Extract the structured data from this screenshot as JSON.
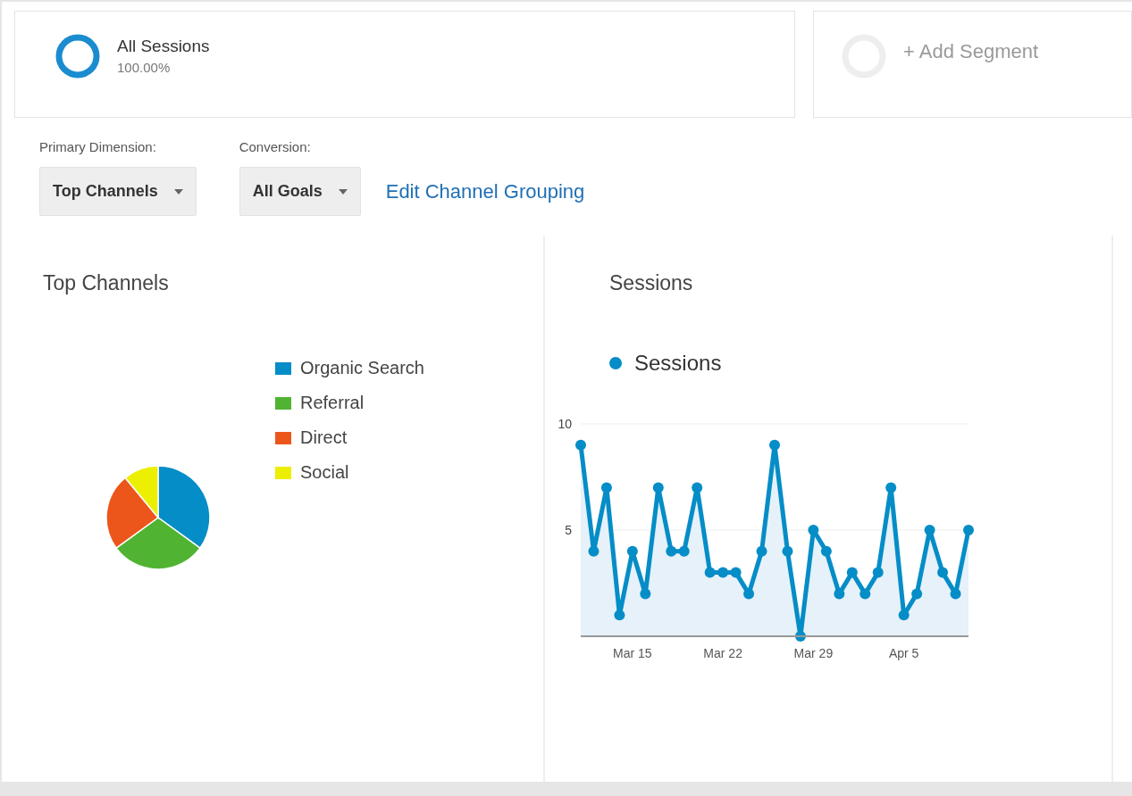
{
  "segments": [
    {
      "name": "All Sessions",
      "percent": "100.00%",
      "kind": "active"
    },
    {
      "name": "+ Add Segment",
      "kind": "add"
    }
  ],
  "controls": {
    "primary_dimension": {
      "label": "Primary Dimension:",
      "value": "Top Channels"
    },
    "conversion": {
      "label": "Conversion:",
      "value": "All Goals"
    },
    "link": "Edit Channel Grouping"
  },
  "top_channels": {
    "title": "Top Channels",
    "legend": [
      {
        "label": "Organic Search",
        "color": "#058dc7"
      },
      {
        "label": "Referral",
        "color": "#50b432"
      },
      {
        "label": "Direct",
        "color": "#ed561b"
      },
      {
        "label": "Social",
        "color": "#edef00"
      }
    ]
  },
  "sessions": {
    "title": "Sessions",
    "chart_data": {
      "type": "line",
      "categories": [
        null,
        null,
        null,
        null,
        "Mar 15",
        null,
        null,
        null,
        null,
        null,
        null,
        "Mar 22",
        null,
        null,
        null,
        null,
        null,
        null,
        "Mar 29",
        null,
        null,
        null,
        null,
        null,
        null,
        "Apr 5",
        null,
        null,
        null,
        null,
        null
      ],
      "series": [
        {
          "name": "Sessions",
          "color": "#058dc7",
          "marker": "circle",
          "values": [
            9,
            4,
            7,
            1,
            4,
            2,
            7,
            4,
            4,
            7,
            3,
            3,
            3,
            2,
            4,
            9,
            4,
            0,
            5,
            4,
            2,
            3,
            2,
            3,
            7,
            1,
            2,
            5,
            3,
            2,
            5
          ]
        }
      ],
      "ylim": [
        0,
        10
      ],
      "yticks": [
        5,
        10
      ]
    }
  }
}
